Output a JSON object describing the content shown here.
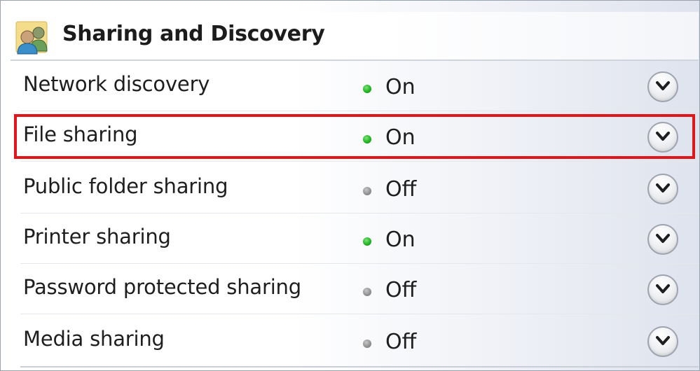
{
  "section": {
    "title": "Sharing and Discovery",
    "icon": "users-icon"
  },
  "rows": [
    {
      "label": "Network discovery",
      "status": "On",
      "state": "on"
    },
    {
      "label": "File sharing",
      "status": "On",
      "state": "on",
      "highlighted": true
    },
    {
      "label": "Public folder sharing",
      "status": "Off",
      "state": "off"
    },
    {
      "label": "Printer sharing",
      "status": "On",
      "state": "on"
    },
    {
      "label": "Password protected sharing",
      "status": "Off",
      "state": "off"
    },
    {
      "label": "Media sharing",
      "status": "Off",
      "state": "off"
    }
  ],
  "colors": {
    "on_dot": "#22b422",
    "off_dot": "#8e8e8e",
    "highlight_border": "#e0161b"
  }
}
